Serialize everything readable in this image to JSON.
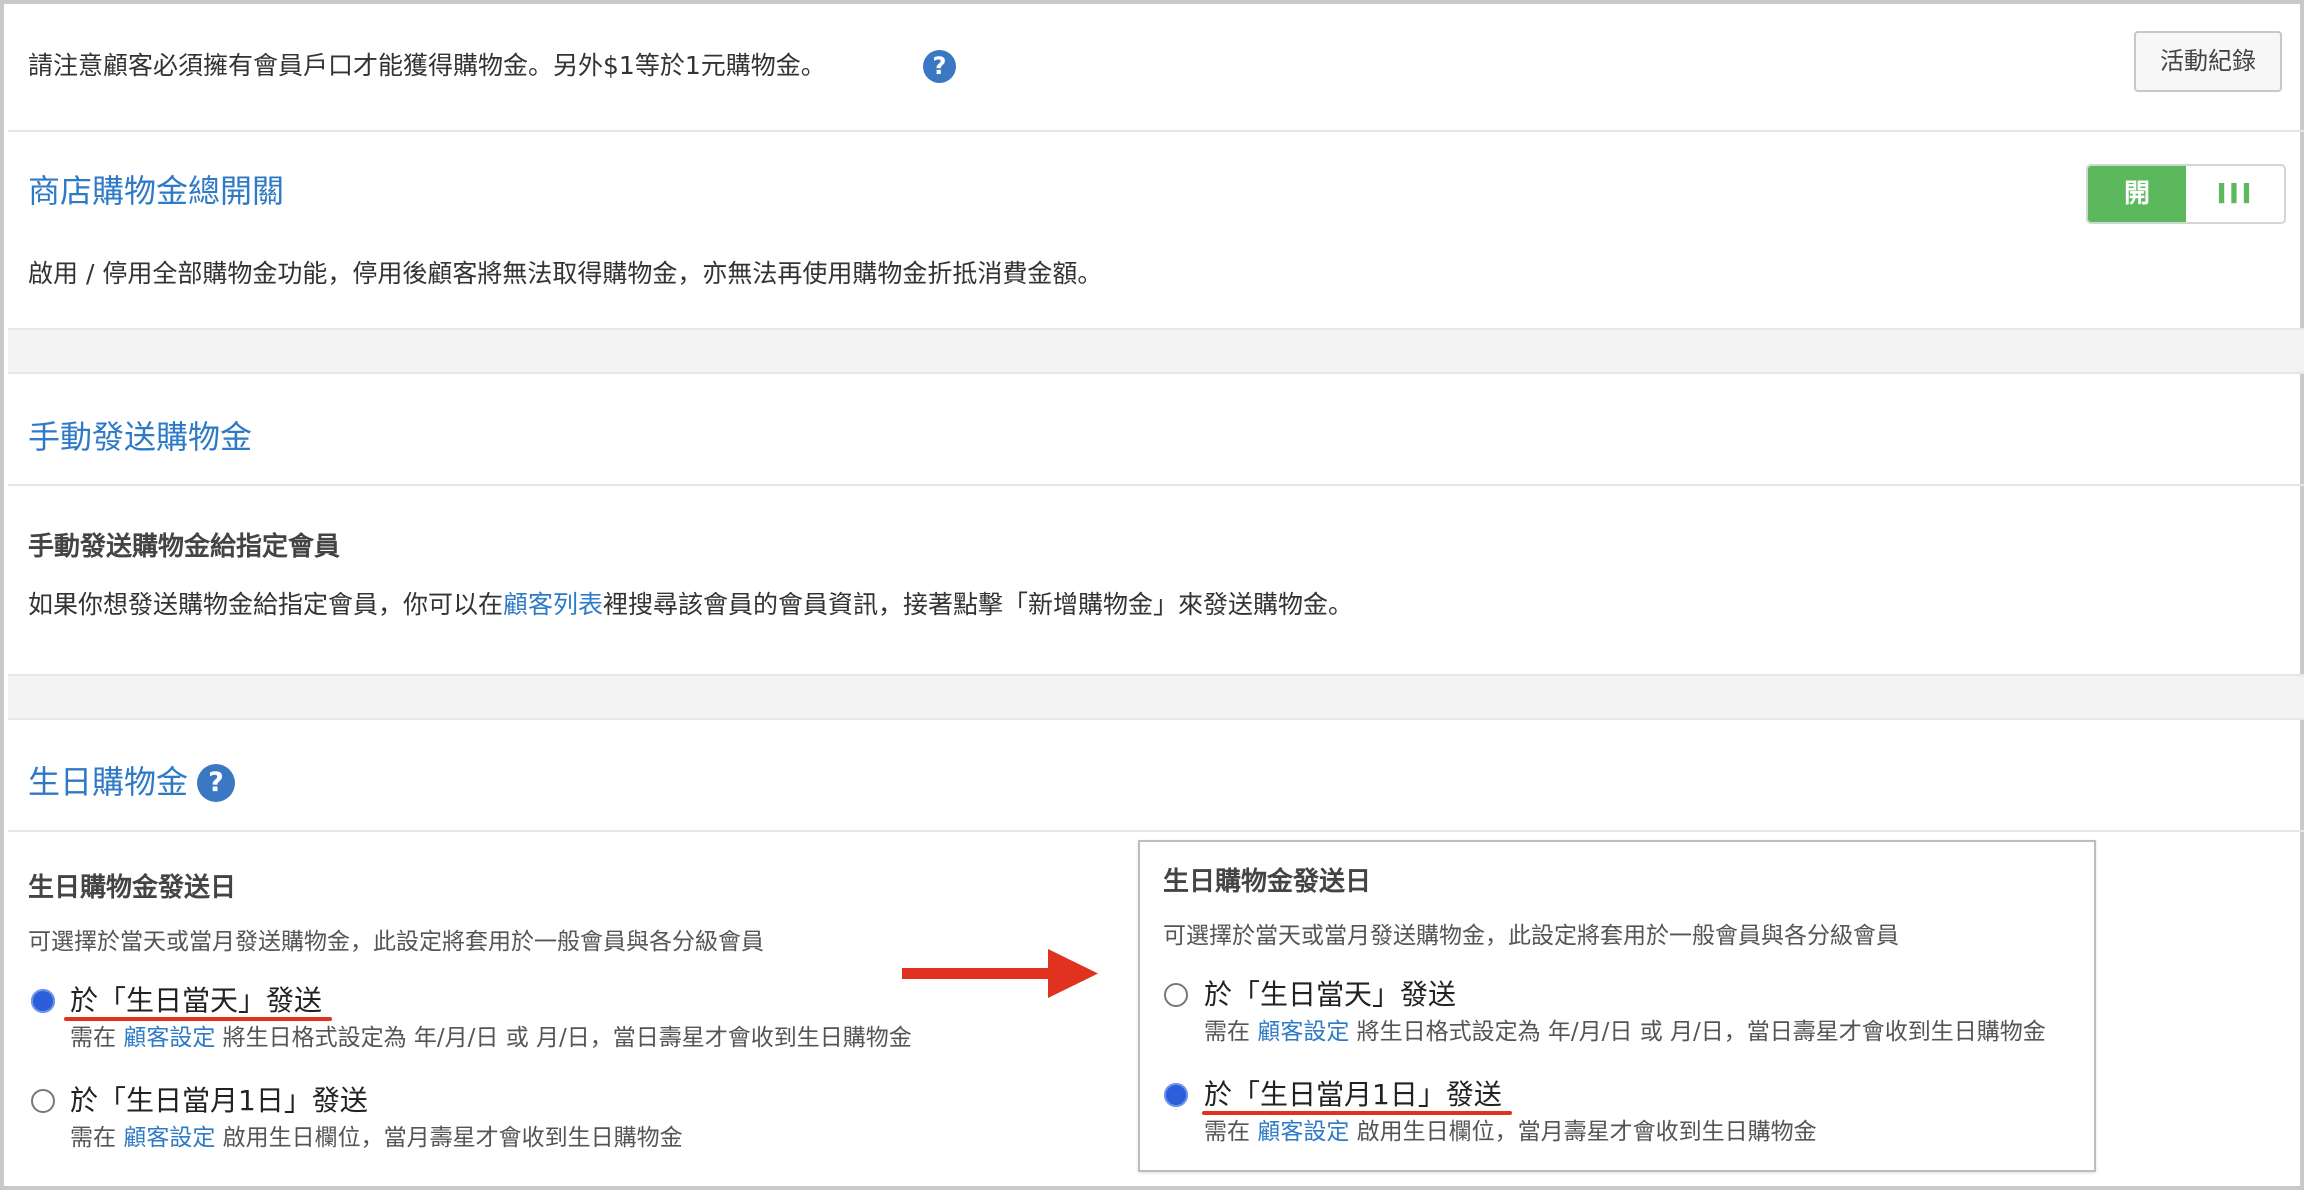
{
  "notice": {
    "text": "請注意顧客必須擁有會員戶口才能獲得購物金。另外$1等於1元購物金。",
    "help_glyph": "?",
    "activity_log_label": "活動紀錄"
  },
  "master_switch": {
    "title": "商店購物金總開關",
    "toggle_on_label": "開",
    "toggle_off_glyph": "III",
    "state": "on",
    "description": "啟用 / 停用全部購物金功能，停用後顧客將無法取得購物金，亦無法再使用購物金折抵消費金額。"
  },
  "manual": {
    "title": "手動發送購物金",
    "subtitle": "手動發送購物金給指定會員",
    "desc_before": "如果你想發送購物金給指定會員，你可以在",
    "desc_link": "顧客列表",
    "desc_after": "裡搜尋該會員的會員資訊，接著點擊「新增購物金」來發送購物金。"
  },
  "birthday": {
    "title": "生日購物金",
    "help_glyph": "?",
    "send_day_label": "生日購物金發送日",
    "send_day_desc": "可選擇於當天或當月發送購物金，此設定將套用於一般會員與各分級會員",
    "option_day": {
      "label": "於「生日當天」發送",
      "note_before": "需在",
      "note_link": "顧客設定",
      "note_after": "將生日格式設定為 年/月/日 或 月/日，當日壽星才會收到生日購物金"
    },
    "option_month": {
      "label": "於「生日當月1日」發送",
      "note_before": "需在",
      "note_link": "顧客設定",
      "note_after": "啟用生日欄位，當月壽星才會收到生日購物金"
    },
    "left_selected": "option_day",
    "right_selected": "option_month"
  },
  "colors": {
    "accent_blue": "#2f7ac6",
    "toggle_green": "#5cb85c",
    "annotation_red": "#e0321e",
    "radio_blue": "#2b5fd9"
  }
}
